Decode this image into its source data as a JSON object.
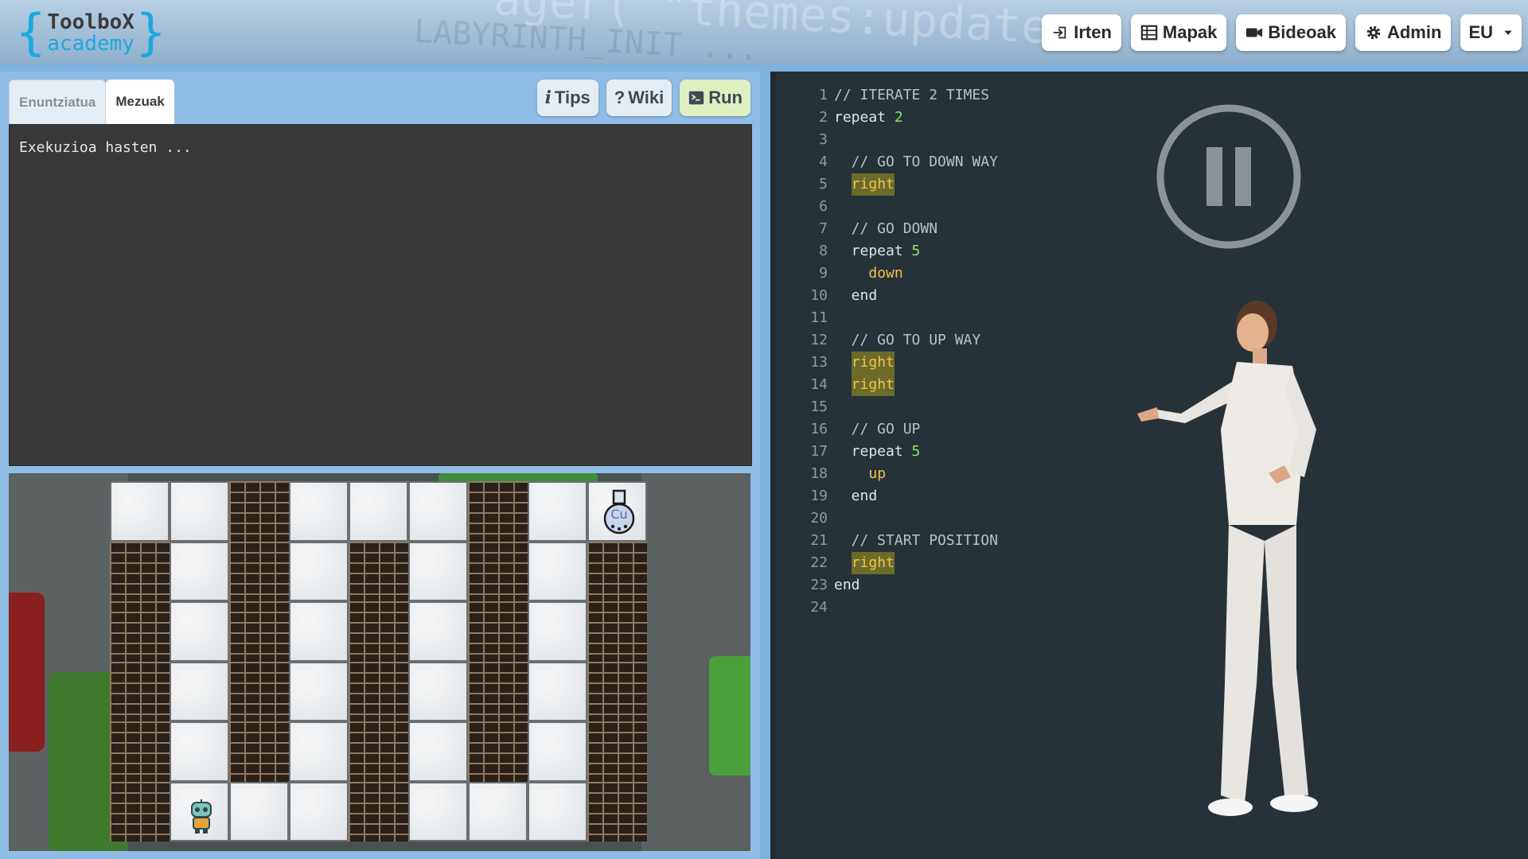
{
  "header": {
    "logo": {
      "line1": "ToolboX",
      "line2": "academy"
    },
    "nav": [
      {
        "label": "Irten",
        "icon": "sign-in-icon"
      },
      {
        "label": "Mapak",
        "icon": "table-icon"
      },
      {
        "label": "Bideoak",
        "icon": "video-camera-icon"
      },
      {
        "label": "Admin",
        "icon": "gear-icon"
      }
    ],
    "language": "EU"
  },
  "left_panel": {
    "tabs": [
      {
        "label": "Enuntziatua",
        "active": false
      },
      {
        "label": "Mezuak",
        "active": true
      }
    ],
    "buttons": {
      "tips": "Tips",
      "wiki": "Wiki",
      "run": "Run"
    },
    "console": {
      "output": "Exekuzioa hasten ..."
    }
  },
  "game": {
    "rows": [
      [
        "floor",
        "floor",
        "wall",
        "floor",
        "floor",
        "floor",
        "wall",
        "floor",
        "goal"
      ],
      [
        "wall",
        "floor",
        "wall",
        "floor",
        "wall",
        "floor",
        "wall",
        "floor",
        "wall"
      ],
      [
        "wall",
        "floor",
        "wall",
        "floor",
        "wall",
        "floor",
        "wall",
        "floor",
        "wall"
      ],
      [
        "wall",
        "floor",
        "wall",
        "floor",
        "wall",
        "floor",
        "wall",
        "floor",
        "wall"
      ],
      [
        "wall",
        "floor",
        "wall",
        "floor",
        "wall",
        "floor",
        "wall",
        "floor",
        "wall"
      ],
      [
        "wall",
        "robot",
        "floor",
        "floor",
        "wall",
        "floor",
        "floor",
        "floor",
        "wall"
      ]
    ],
    "goal_label": "Cu"
  },
  "editor": {
    "lines": [
      [
        {
          "t": "// ITERATE 2 TIMES",
          "c": "comment"
        }
      ],
      [
        {
          "t": "repeat ",
          "c": "kw"
        },
        {
          "t": "2",
          "c": "num"
        }
      ],
      [],
      [
        {
          "t": "  // GO TO DOWN WAY",
          "c": "comment"
        }
      ],
      [
        {
          "t": "  ",
          "c": "kw"
        },
        {
          "t": "right",
          "c": "hl"
        }
      ],
      [],
      [
        {
          "t": "  // GO DOWN",
          "c": "comment"
        }
      ],
      [
        {
          "t": "  repeat ",
          "c": "kw"
        },
        {
          "t": "5",
          "c": "num"
        }
      ],
      [
        {
          "t": "    ",
          "c": "kw"
        },
        {
          "t": "down",
          "c": "action"
        }
      ],
      [
        {
          "t": "  end",
          "c": "kw"
        }
      ],
      [],
      [
        {
          "t": "  // GO TO UP WAY",
          "c": "comment"
        }
      ],
      [
        {
          "t": "  ",
          "c": "kw"
        },
        {
          "t": "right",
          "c": "hl"
        }
      ],
      [
        {
          "t": "  ",
          "c": "kw"
        },
        {
          "t": "right",
          "c": "hl"
        }
      ],
      [],
      [
        {
          "t": "  // GO UP",
          "c": "comment"
        }
      ],
      [
        {
          "t": "  repeat ",
          "c": "kw"
        },
        {
          "t": "5",
          "c": "num"
        }
      ],
      [
        {
          "t": "    ",
          "c": "kw"
        },
        {
          "t": "up",
          "c": "action"
        }
      ],
      [
        {
          "t": "  end",
          "c": "kw"
        }
      ],
      [],
      [
        {
          "t": "  // START POSITION",
          "c": "comment"
        }
      ],
      [
        {
          "t": "  ",
          "c": "kw"
        },
        {
          "t": "right",
          "c": "hl"
        }
      ],
      [
        {
          "t": "end",
          "c": "kw"
        }
      ],
      []
    ],
    "overlay_icon": "pause-icon"
  },
  "colors": {
    "accent": "#1fa8e0",
    "editor_bg": "#263238",
    "panel_bg": "#8fbde6"
  }
}
